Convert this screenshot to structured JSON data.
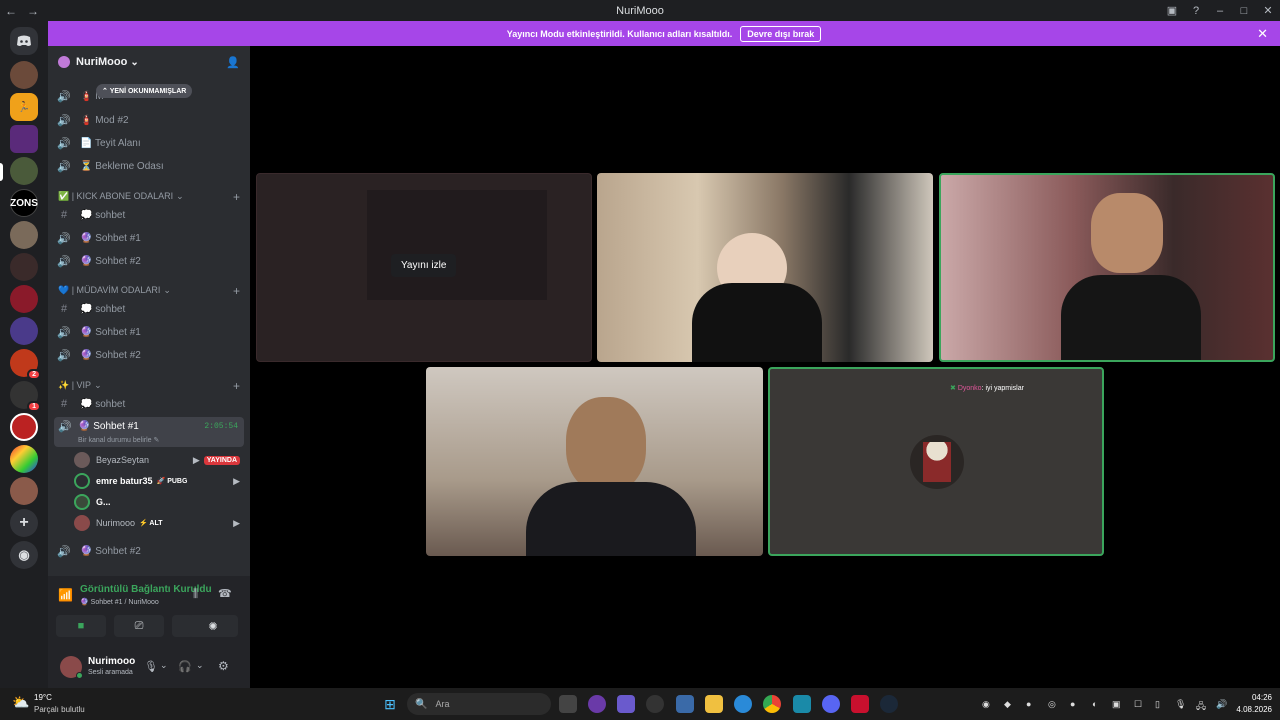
{
  "window": {
    "title": "NuriMooo",
    "nav_back": "←",
    "nav_fwd": "→"
  },
  "banner": {
    "text": "Yayıncı Modu etkinleştirildi. Kullanıcı adları kısaltıldı.",
    "button": "Devre dışı bırak",
    "close": "✕"
  },
  "guilds": {
    "badges": [
      "2",
      "1"
    ]
  },
  "server": {
    "name": "NuriMooo",
    "chevron": "⌄"
  },
  "unread_pill": "YENİ OKUNMAMIŞLAR",
  "channels_top": [
    {
      "label": "🧯 M",
      "icon": "speaker-icon"
    },
    {
      "label": "🧯 Mod #2",
      "icon": "speaker-icon"
    },
    {
      "label": "📄 Teyit Alanı",
      "icon": "speaker-icon"
    },
    {
      "label": "⏳ Bekleme Odası",
      "icon": "speaker-icon"
    }
  ],
  "categories": [
    {
      "label": "✅ | KICK ABONE ODALARI",
      "channels": [
        {
          "label": "💭 sohbet",
          "icon": "hash-icon"
        },
        {
          "label": "🔮 Sohbet #1",
          "icon": "speaker-icon"
        },
        {
          "label": "🔮 Sohbet #2",
          "icon": "speaker-icon"
        }
      ]
    },
    {
      "label": "💙 | MÜDAVİM ODALARI",
      "channels": [
        {
          "label": "💭 sohbet",
          "icon": "hash-icon"
        },
        {
          "label": "🔮 Sohbet #1",
          "icon": "speaker-icon"
        },
        {
          "label": "🔮 Sohbet #2",
          "icon": "speaker-icon"
        }
      ]
    },
    {
      "label": "✨ | VIP",
      "channels": [
        {
          "label": "💭 sohbet",
          "icon": "hash-icon"
        }
      ]
    }
  ],
  "active_channel": {
    "label": "🔮 Sohbet #1",
    "status_prompt": "Bir kanal durumu belirle",
    "timer": "2:05:54",
    "members": [
      {
        "name": "BeyazSeytan",
        "tag": "",
        "badge": "YAYINDA",
        "camera": true
      },
      {
        "name": "emre batur35",
        "tag": "🚀 PUBG",
        "badge": "",
        "camera": true
      },
      {
        "name": "G...",
        "tag": "",
        "badge": "",
        "camera": false
      },
      {
        "name": "Nurimooo",
        "tag": "⚡ ALT",
        "badge": "",
        "camera": true
      }
    ]
  },
  "after_channel": {
    "label": "🔮 Sohbet #2"
  },
  "voice_panel": {
    "status": "Görüntülü Bağlantı Kuruldu",
    "location": "🔮 Sohbet #1 / NuriMooo"
  },
  "user_panel": {
    "name": "Nurimooo",
    "status": "Sesli aramada"
  },
  "stage": {
    "watch_stream": "Yayını izle",
    "chat_overlay_user": "Dyonko",
    "chat_overlay_msg": ": iyi yapmislar"
  },
  "taskbar": {
    "weather_temp": "19°C",
    "weather_desc": "Parçalı bulutlu",
    "search_placeholder": "Ara",
    "time": "04:26",
    "date": "4.08.2026"
  },
  "colors": {
    "accent": "#a646e8",
    "speaking": "#3ba55c",
    "live": "#da373c"
  }
}
